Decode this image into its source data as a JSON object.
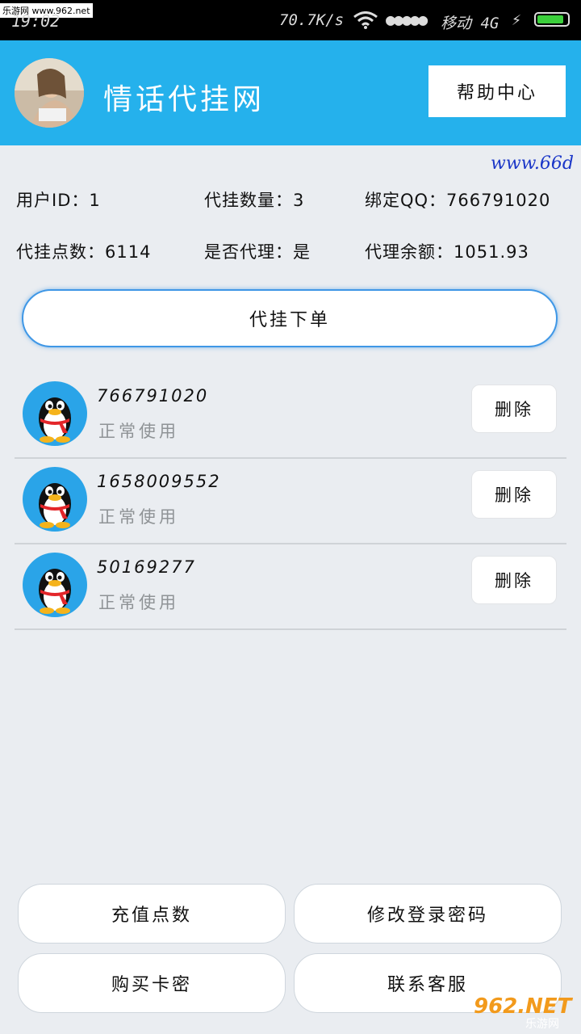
{
  "status_bar": {
    "watermark": "乐游网 www.962.net",
    "time": "19:02",
    "network_speed": "70.7K/s",
    "signal": "●●●●●",
    "carrier": "移动 4G",
    "battery_level": 0.9
  },
  "header": {
    "title": "情话代挂网",
    "help_label": "帮助中心"
  },
  "marquee_url": "www.66d",
  "info": {
    "user_id": "用户ID：1",
    "count": "代挂数量：3",
    "bound_qq": "绑定QQ：766791020",
    "points": "代挂点数：6114",
    "is_agent": "是否代理：是",
    "agent_balance": "代理余额：1051.93"
  },
  "order_label": "代挂下单",
  "accounts": [
    {
      "qq": "766791020",
      "status": "正常使用",
      "delete_label": "删除"
    },
    {
      "qq": "1658009552",
      "status": "正常使用",
      "delete_label": "删除"
    },
    {
      "qq": "50169277",
      "status": "正常使用",
      "delete_label": "删除"
    }
  ],
  "bottom": {
    "recharge": "充值点数",
    "change_password": "修改登录密码",
    "buy_card": "购买卡密",
    "contact": "联系客服"
  },
  "logo_text": "962.NET",
  "logo_sub": "乐游网",
  "colors": {
    "header_bg": "#25b1ec",
    "page_bg": "#eaedf1",
    "accent_border": "#3f97e6",
    "status_gray": "#8f9396"
  }
}
